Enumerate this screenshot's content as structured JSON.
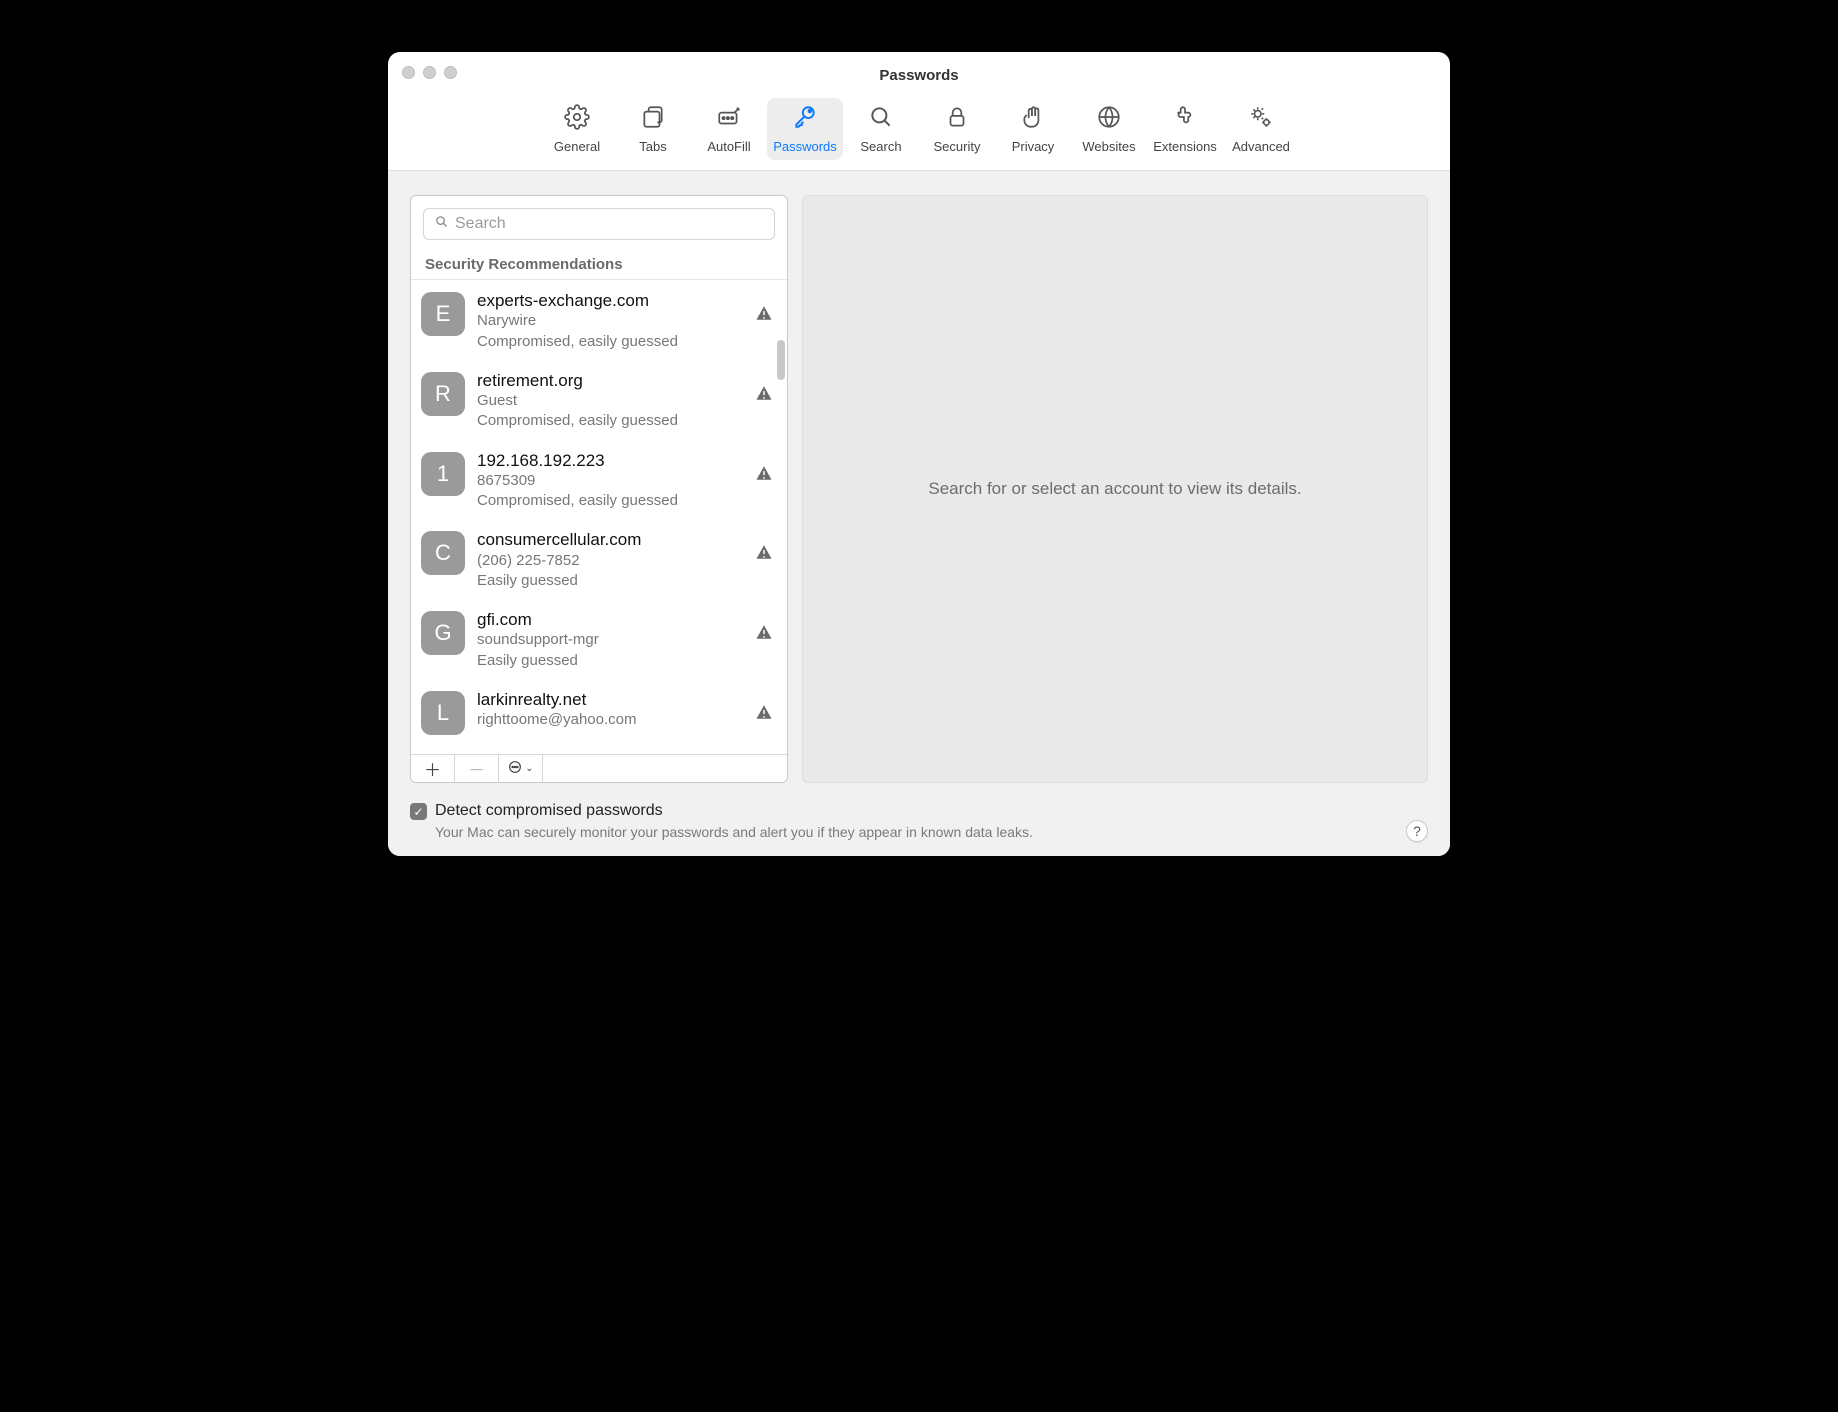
{
  "window": {
    "title": "Passwords"
  },
  "toolbar": {
    "items": [
      {
        "id": "general",
        "label": "General"
      },
      {
        "id": "tabs",
        "label": "Tabs"
      },
      {
        "id": "autofill",
        "label": "AutoFill"
      },
      {
        "id": "passwords",
        "label": "Passwords"
      },
      {
        "id": "search",
        "label": "Search"
      },
      {
        "id": "security",
        "label": "Security"
      },
      {
        "id": "privacy",
        "label": "Privacy"
      },
      {
        "id": "websites",
        "label": "Websites"
      },
      {
        "id": "extensions",
        "label": "Extensions"
      },
      {
        "id": "advanced",
        "label": "Advanced"
      }
    ],
    "active": "passwords"
  },
  "sidebar": {
    "search_placeholder": "Search",
    "section_header": "Security Recommendations",
    "items": [
      {
        "letter": "E",
        "site": "experts-exchange.com",
        "user": "Narywire",
        "status": "Compromised, easily guessed"
      },
      {
        "letter": "R",
        "site": "retirement.org",
        "user": "Guest",
        "status": "Compromised, easily guessed"
      },
      {
        "letter": "1",
        "site": "192.168.192.223",
        "user": "8675309",
        "status": "Compromised, easily guessed"
      },
      {
        "letter": "C",
        "site": "consumercellular.com",
        "user": "(206) 225-7852",
        "status": "Easily guessed"
      },
      {
        "letter": "G",
        "site": "gfi.com",
        "user": "soundsupport-mgr",
        "status": "Easily guessed"
      },
      {
        "letter": "L",
        "site": "larkinrealty.net",
        "user": "righttoome@yahoo.com",
        "status": ""
      }
    ]
  },
  "detail": {
    "placeholder": "Search for or select an account to view its details."
  },
  "footer": {
    "checkbox_label": "Detect compromised passwords",
    "description": "Your Mac can securely monitor your passwords and alert you if they appear in known data leaks.",
    "checked": true,
    "help_label": "?"
  }
}
